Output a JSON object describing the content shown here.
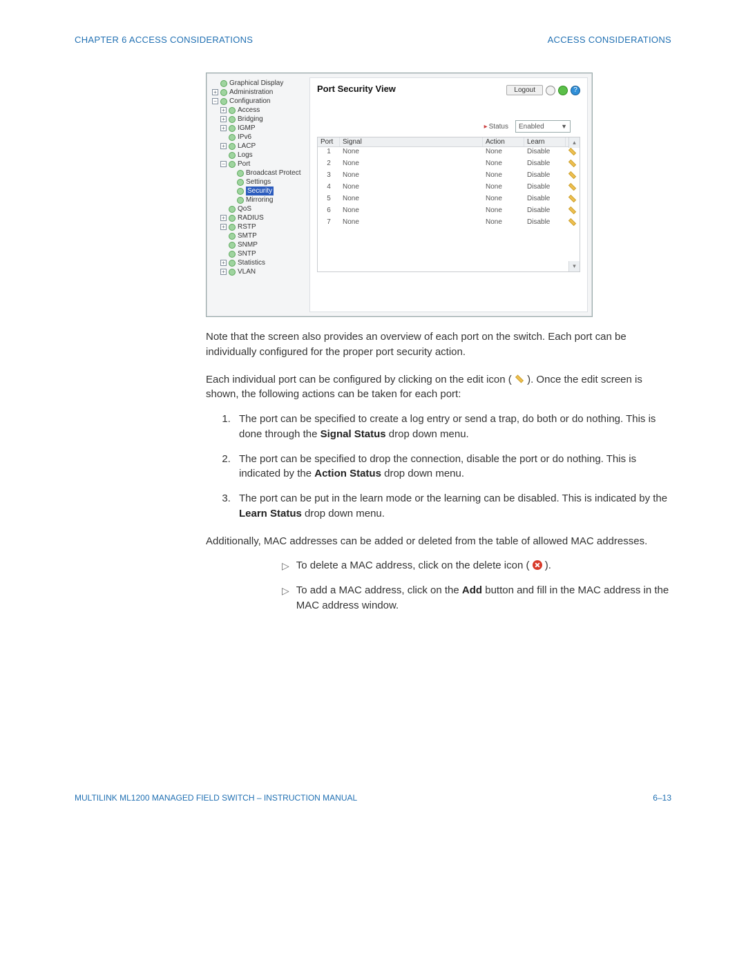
{
  "header": {
    "left": "CHAPTER 6  ACCESS CONSIDERATIONS",
    "right": "ACCESS CONSIDERATIONS"
  },
  "footer": {
    "left": "MULTILINK ML1200 MANAGED FIELD SWITCH – INSTRUCTION MANUAL",
    "right": "6–13"
  },
  "screenshot": {
    "title": "Port Security View",
    "logout": "Logout",
    "status_label": "Status",
    "status_value": "Enabled",
    "tree": [
      {
        "indent": 0,
        "exp": "",
        "label": "Graphical Display"
      },
      {
        "indent": 0,
        "exp": "plus",
        "label": "Administration"
      },
      {
        "indent": 0,
        "exp": "minus",
        "label": "Configuration"
      },
      {
        "indent": 1,
        "exp": "plus",
        "label": "Access"
      },
      {
        "indent": 1,
        "exp": "plus",
        "label": "Bridging"
      },
      {
        "indent": 1,
        "exp": "plus",
        "label": "IGMP"
      },
      {
        "indent": 1,
        "exp": "",
        "label": "IPv6"
      },
      {
        "indent": 1,
        "exp": "plus",
        "label": "LACP"
      },
      {
        "indent": 1,
        "exp": "",
        "label": "Logs"
      },
      {
        "indent": 1,
        "exp": "minus",
        "label": "Port"
      },
      {
        "indent": 2,
        "exp": "",
        "label": "Broadcast Protect"
      },
      {
        "indent": 2,
        "exp": "",
        "label": "Settings"
      },
      {
        "indent": 2,
        "exp": "",
        "label": "Security",
        "selected": true
      },
      {
        "indent": 2,
        "exp": "",
        "label": "Mirroring"
      },
      {
        "indent": 1,
        "exp": "",
        "label": "QoS"
      },
      {
        "indent": 1,
        "exp": "plus",
        "label": "RADIUS"
      },
      {
        "indent": 1,
        "exp": "plus",
        "label": "RSTP"
      },
      {
        "indent": 1,
        "exp": "",
        "label": "SMTP"
      },
      {
        "indent": 1,
        "exp": "",
        "label": "SNMP"
      },
      {
        "indent": 1,
        "exp": "",
        "label": "SNTP"
      },
      {
        "indent": 1,
        "exp": "plus",
        "label": "Statistics"
      },
      {
        "indent": 1,
        "exp": "plus",
        "label": "VLAN"
      }
    ],
    "columns": {
      "c1": "Port",
      "c2": "Signal",
      "c3": "Action",
      "c4": "Learn"
    },
    "rows": [
      {
        "port": "1",
        "signal": "None",
        "action": "None",
        "learn": "Disable"
      },
      {
        "port": "2",
        "signal": "None",
        "action": "None",
        "learn": "Disable"
      },
      {
        "port": "3",
        "signal": "None",
        "action": "None",
        "learn": "Disable"
      },
      {
        "port": "4",
        "signal": "None",
        "action": "None",
        "learn": "Disable"
      },
      {
        "port": "5",
        "signal": "None",
        "action": "None",
        "learn": "Disable"
      },
      {
        "port": "6",
        "signal": "None",
        "action": "None",
        "learn": "Disable"
      },
      {
        "port": "7",
        "signal": "None",
        "action": "None",
        "learn": "Disable"
      }
    ]
  },
  "body": {
    "p1": "Note that the screen also provides an overview of each port on the switch. Each port can be individually configured for the proper port security action.",
    "p2a": "Each individual port can be configured by clicking on the edit icon ( ",
    "p2b": " ). Once the edit screen is shown, the following actions can be taken for each port:",
    "steps": [
      {
        "pre": "The port can be specified to create a log entry or send a trap, do both or do nothing. This is done through the ",
        "bold": "Signal Status",
        "post": " drop down menu."
      },
      {
        "pre": "The port can be specified to drop the connection, disable the port or do nothing. This is indicated by the ",
        "bold": "Action Status",
        "post": " drop down menu."
      },
      {
        "pre": "The port can be put in the learn mode or the learning can be disabled. This is indicated by the ",
        "bold": "Learn Status",
        "post": " drop down menu."
      }
    ],
    "p3": "Additionally, MAC addresses can be added or deleted from the table of allowed MAC addresses.",
    "b1a": "To delete a MAC address, click on the delete icon ( ",
    "b1b": " ).",
    "b2a": "To add a MAC address, click on the ",
    "b2bold": "Add",
    "b2b": " button and fill in the MAC address in the MAC address window."
  }
}
